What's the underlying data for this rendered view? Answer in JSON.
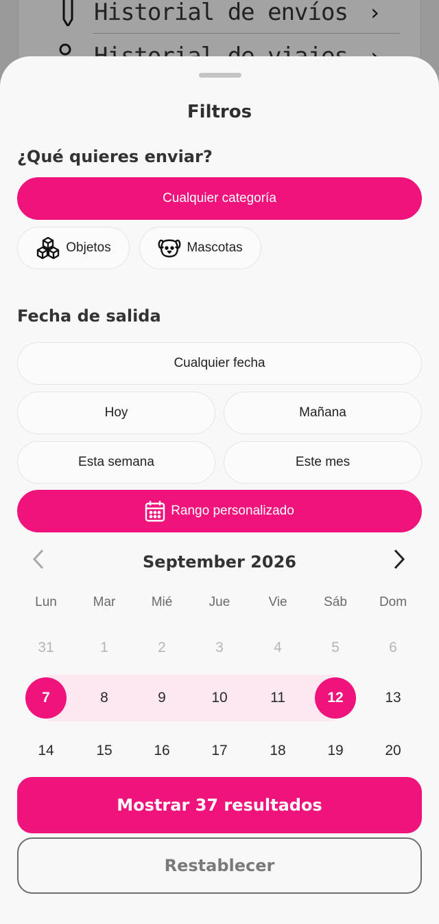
{
  "background": {
    "row1_label": "Historial de envíos",
    "row2_label": "Historial de viajes"
  },
  "sheet": {
    "title": "Filtros"
  },
  "what": {
    "title": "¿Qué quieres enviar?",
    "any_category": "Cualquier categoría",
    "objects": "Objetos",
    "pets": "Mascotas"
  },
  "date": {
    "title": "Fecha de salida",
    "any_date": "Cualquier fecha",
    "today": "Hoy",
    "tomorrow": "Mañana",
    "this_week": "Esta semana",
    "this_month": "Este mes",
    "custom_range": "Rango personalizado"
  },
  "calendar": {
    "month_title": "September 2026",
    "weekdays": [
      "Lun",
      "Mar",
      "Mié",
      "Jue",
      "Vie",
      "Sáb",
      "Dom"
    ],
    "weeks": [
      [
        "31",
        "1",
        "2",
        "3",
        "4",
        "5",
        "6"
      ],
      [
        "7",
        "8",
        "9",
        "10",
        "11",
        "12",
        "13"
      ],
      [
        "14",
        "15",
        "16",
        "17",
        "18",
        "19",
        "20"
      ]
    ],
    "range_start": "7",
    "range_end": "12"
  },
  "actions": {
    "show_results": "Mostrar 37 resultados",
    "reset": "Restablecer"
  },
  "colors": {
    "accent": "#f0137c",
    "range_band": "#fde8f1"
  },
  "icons": {
    "objects": "cubes-icon",
    "pets": "dog-icon",
    "custom_range": "calendar-icon",
    "prev_month": "chevron-left-icon",
    "next_month": "chevron-right-icon"
  }
}
